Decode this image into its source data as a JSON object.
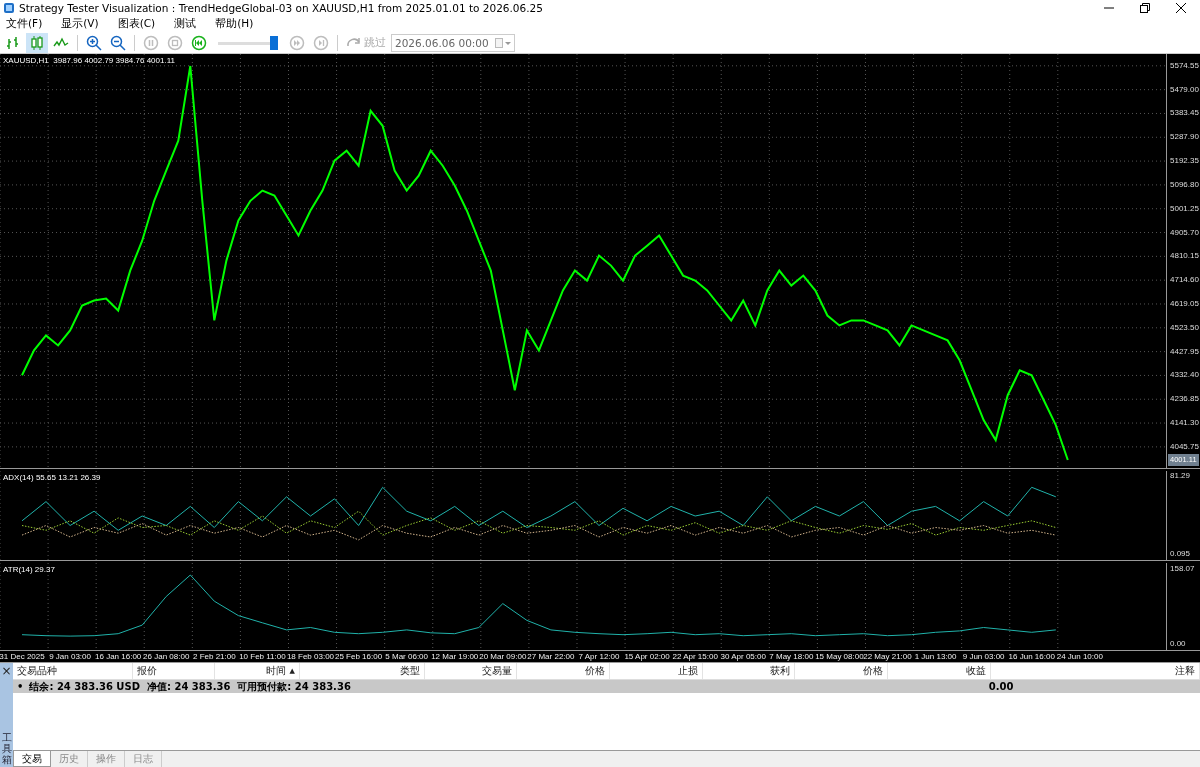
{
  "window": {
    "title": "Strategy Tester Visualization : TrendHedgeGlobal-03 on XAUUSD,H1 from 2025.01.01 to 2026.06.25"
  },
  "menu": [
    "文件(F)",
    "显示(V)",
    "图表(C)",
    "测试",
    "帮助(H)"
  ],
  "toolbar": {
    "chart_modes": [
      {
        "kind": "bars",
        "selected": false
      },
      {
        "kind": "candles",
        "selected": true
      },
      {
        "kind": "line",
        "selected": false
      }
    ],
    "playback": [
      {
        "kind": "pause",
        "disabled": true
      },
      {
        "kind": "stop",
        "disabled": true
      },
      {
        "kind": "rewind",
        "disabled": false
      }
    ],
    "speed": {
      "level": 0.93
    },
    "stepping": [
      {
        "kind": "fast-forward",
        "disabled": true
      },
      {
        "kind": "skip-end",
        "disabled": true
      }
    ],
    "skip": {
      "label": "跳过",
      "disabled": true
    },
    "date": {
      "value": "2026.06.06 00:00"
    }
  },
  "price_pane": {
    "legend": "XAUUSD,H1  3987.96 4002.79 3984.76 4001.11",
    "price_tag": "4001.11",
    "chart_data": {
      "type": "line",
      "grid": true,
      "ylim": [
        3961,
        5622
      ],
      "categories": [
        null,
        null,
        null,
        null,
        null,
        null,
        null,
        null,
        null,
        null,
        null,
        null,
        null,
        null,
        null,
        null,
        null,
        null,
        null,
        null,
        null,
        null,
        null,
        null,
        null,
        null,
        null,
        null,
        null,
        null,
        null,
        null,
        null,
        null,
        null,
        null,
        null,
        null,
        null,
        null,
        null,
        null,
        null,
        null,
        null,
        null,
        null,
        null,
        null,
        null,
        null,
        null,
        null,
        null,
        null,
        null,
        null,
        null,
        null,
        null,
        null,
        null,
        null,
        null,
        null,
        null,
        null,
        null,
        null,
        null,
        null,
        null,
        null,
        null,
        null,
        null,
        null,
        null,
        null,
        null,
        null,
        null,
        null,
        null,
        null,
        null,
        null,
        null
      ],
      "series": [
        {
          "color": "#00ff00",
          "values": [
            4333,
            4433,
            4493,
            4453,
            4513,
            4613,
            4633,
            4641,
            4593,
            4753,
            4873,
            5033,
            5154,
            5274,
            5574,
            5033,
            4553,
            4793,
            4954,
            5033,
            5074,
            5054,
            4974,
            4894,
            4994,
            5074,
            5194,
            5234,
            5174,
            5394,
            5334,
            5154,
            5074,
            5134,
            5234,
            5174,
            5094,
            4994,
            4873,
            4753,
            4513,
            4273,
            4513,
            4433,
            4553,
            4673,
            4753,
            4713,
            4813,
            4773,
            4713,
            4813,
            4853,
            4894,
            4813,
            4733,
            4713,
            4673,
            4613,
            4553,
            4633,
            4533,
            4673,
            4753,
            4693,
            4733,
            4673,
            4573,
            4533,
            4553,
            4553,
            4533,
            4513,
            4453,
            4533,
            4513,
            4493,
            4473,
            4393,
            4273,
            4153,
            4073,
            4253,
            4353,
            4333,
            4233,
            4133,
            3993
          ]
        }
      ],
      "yticks": [
        {
          "value": 5574.55,
          "label": "5574.55"
        },
        {
          "value": 5479.0,
          "label": "5479.00"
        },
        {
          "value": 5383.45,
          "label": "5383.45"
        },
        {
          "value": 5287.9,
          "label": "5287.90"
        },
        {
          "value": 5192.35,
          "label": "5192.35"
        },
        {
          "value": 5096.8,
          "label": "5096.80"
        },
        {
          "value": 5001.25,
          "label": "5001.25"
        },
        {
          "value": 4905.7,
          "label": "4905.70"
        },
        {
          "value": 4810.15,
          "label": "4810.15"
        },
        {
          "value": 4714.6,
          "label": "4714.60"
        },
        {
          "value": 4619.05,
          "label": "4619.05"
        },
        {
          "value": 4523.5,
          "label": "4523.50"
        },
        {
          "value": 4427.95,
          "label": "4427.95"
        },
        {
          "value": 4332.4,
          "label": "4332.40"
        },
        {
          "value": 4236.85,
          "label": "4236.85"
        },
        {
          "value": 4141.3,
          "label": "4141.30"
        },
        {
          "value": 4045.75,
          "label": "4045.75"
        }
      ]
    }
  },
  "adx_pane": {
    "legend": "ADX(14) 55.65 13.21 26.39",
    "chart_data": {
      "type": "line",
      "grid": true,
      "ylim": [
        -6,
        87
      ],
      "categories": [
        null,
        null,
        null,
        null,
        null,
        null,
        null,
        null,
        null,
        null,
        null,
        null,
        null,
        null,
        null,
        null,
        null,
        null,
        null,
        null,
        null,
        null,
        null,
        null,
        null,
        null,
        null,
        null,
        null,
        null,
        null,
        null,
        null,
        null,
        null,
        null,
        null,
        null,
        null,
        null,
        null,
        null,
        null,
        null
      ],
      "series": [
        {
          "color": "#20b2aa",
          "values": [
            35,
            55,
            30,
            45,
            25,
            40,
            30,
            50,
            28,
            55,
            35,
            60,
            40,
            58,
            30,
            70,
            45,
            35,
            50,
            30,
            45,
            28,
            40,
            55,
            30,
            48,
            35,
            50,
            40,
            45,
            30,
            60,
            35,
            50,
            40,
            55,
            30,
            45,
            50,
            35,
            55,
            40,
            70,
            60
          ]
        },
        {
          "color": "#9acd32",
          "line_style": "dotted",
          "values": [
            30,
            25,
            35,
            22,
            38,
            28,
            30,
            20,
            35,
            25,
            40,
            22,
            35,
            28,
            45,
            20,
            30,
            38,
            25,
            35,
            22,
            30,
            28,
            25,
            35,
            20,
            30,
            25,
            33,
            22,
            30,
            25,
            35,
            28,
            22,
            30,
            26,
            32,
            20,
            28,
            25,
            30,
            35,
            28
          ]
        },
        {
          "color": "#d2b48c",
          "line_style": "dotted",
          "values": [
            20,
            30,
            18,
            28,
            22,
            32,
            20,
            30,
            22,
            28,
            18,
            30,
            20,
            25,
            15,
            30,
            22,
            18,
            28,
            20,
            30,
            22,
            25,
            30,
            18,
            28,
            22,
            30,
            20,
            28,
            22,
            30,
            18,
            25,
            28,
            20,
            30,
            22,
            28,
            25,
            30,
            22,
            25,
            20
          ]
        }
      ],
      "yticks": [
        {
          "value": 81.29,
          "label": "81.29"
        },
        {
          "value": 0.095,
          "label": "0.095"
        }
      ]
    }
  },
  "atr_pane": {
    "legend": "ATR(14) 29.37",
    "chart_data": {
      "type": "line",
      "grid": true,
      "ylim": [
        -12,
        170
      ],
      "categories": [
        "31 Dec 2025",
        null,
        "9 Jan 03:00",
        null,
        "16 Jan 16:00",
        null,
        "26 Jan 08:00",
        null,
        "2 Feb 21:00",
        null,
        "10 Feb 11:00",
        null,
        "18 Feb 03:00",
        null,
        "25 Feb 16:00",
        null,
        "5 Mar 06:00",
        null,
        "12 Mar 19:00",
        null,
        "20 Mar 09:00",
        null,
        "27 Mar 22:00",
        null,
        "7 Apr 12:00",
        null,
        "15 Apr 02:00",
        null,
        "22 Apr 15:00",
        null,
        "30 Apr 05:00",
        null,
        "7 May 18:00",
        null,
        "15 May 08:00",
        null,
        "22 May 21:00",
        null,
        "1 Jun 13:00",
        null,
        "9 Jun 03:00",
        null,
        "16 Jun 16:00",
        null,
        "24 Jun 10:00"
      ],
      "series": [
        {
          "color": "#20b2aa",
          "values": [
            20,
            18,
            17,
            18,
            22,
            40,
            100,
            145,
            90,
            60,
            45,
            30,
            35,
            25,
            22,
            25,
            30,
            24,
            22,
            35,
            85,
            50,
            30,
            25,
            22,
            20,
            22,
            25,
            20,
            22,
            18,
            20,
            22,
            18,
            20,
            22,
            18,
            20,
            25,
            28,
            35,
            30,
            25,
            30,
            null
          ]
        }
      ],
      "yticks": [
        {
          "value": 158.07,
          "label": "158.07"
        },
        {
          "value": 0,
          "label": "0.00"
        }
      ]
    }
  },
  "toolbox": {
    "close": "×",
    "title": "工具箱",
    "columns": [
      {
        "label": "交易品种"
      },
      {
        "label": "报价"
      },
      {
        "label": "时间",
        "sort": "▲"
      },
      {
        "label": "类型"
      },
      {
        "label": "交易量"
      },
      {
        "label": "价格"
      },
      {
        "label": "止损"
      },
      {
        "label": "获利"
      },
      {
        "label": "价格"
      },
      {
        "label": "收益"
      },
      {
        "label": "注释"
      }
    ],
    "summary": {
      "bullet": "•",
      "text": "结余: 24 383.36 USD  净值: 24 383.36  可用预付款: 24 383.36",
      "profit": "0.00"
    },
    "tabs": [
      {
        "label": "交易",
        "selected": true
      },
      {
        "label": "历史",
        "selected": false
      },
      {
        "label": "操作",
        "selected": false
      },
      {
        "label": "日志",
        "selected": false
      }
    ]
  }
}
